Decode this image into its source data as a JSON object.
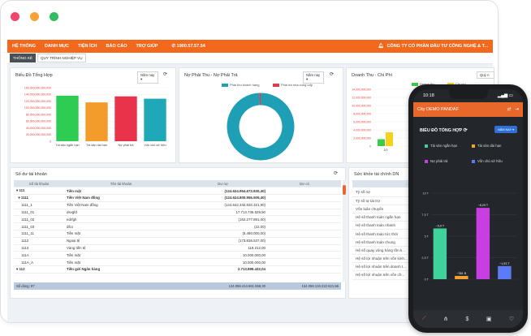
{
  "menu": {
    "items": [
      "HỆ THỐNG",
      "DANH MỤC",
      "TIỆN ÍCH",
      "BÁO CÁO",
      "TRỢ GIÚP"
    ],
    "phone": "1900.57.57.54",
    "company": "CÔNG TY CỔ PHẦN ĐẦU TƯ CÔNG NGHỆ & T..."
  },
  "tabs": [
    "THỐNG KÊ",
    "QUY TRÌNH NGHIỆP VỤ"
  ],
  "overview": {
    "title": "Biểu Đồ Tổng Hợp",
    "period": "Năm nay",
    "y_ticks": [
      "160,000,000,000,000",
      "140,000,000,000,000",
      "120,000,000,000,000",
      "100,000,000,000,000",
      "80,000,000,000,000",
      "60,000,000,000,000",
      "40,000,000,000,000",
      "20,000,000,000,000",
      "0"
    ]
  },
  "receivable": {
    "title": "Nợ Phải Thu - Nợ Phải Trả",
    "period": "Năm nay",
    "legend": [
      {
        "name": "Phải thu khách hàng",
        "color": "#1f9fb5"
      },
      {
        "name": "Phải trả nhà cung cấp",
        "color": "#e53945"
      }
    ]
  },
  "income": {
    "title": "Doanh Thu - Chi Phí",
    "period": "Quý n",
    "legend": [
      {
        "name": "Doanh thu",
        "color": "#3ec94a"
      },
      {
        "name": "Chi phí",
        "color": "#f6d21a"
      }
    ],
    "y_ticks": [
      "14,000,000,000",
      "12,000,000,000",
      "10,000,000,000",
      "8,000,000,000",
      "6,000,000,000",
      "4,000,000,000",
      "2,000,000,000",
      "0"
    ],
    "x_label": "1/0"
  },
  "balance": {
    "title": "Số dư tài khoản",
    "headers": [
      "Số tài khoản",
      "Tên tài khoản",
      "Dư nợ",
      "Dư có"
    ],
    "rows": [
      {
        "acct": "111",
        "name": "Tiền mặt",
        "debit": "(124.624.954.673.830,40)",
        "credit": "",
        "level": 0
      },
      {
        "acct": "1111",
        "name": "Tiền Việt Nam đồng",
        "debit": "(124.624.800.955.505,40)",
        "credit": "",
        "level": 1
      },
      {
        "acct": "1111_1",
        "name": "Tiền Việt Nam đồng",
        "debit": "(124.642.342.833.321,90)",
        "credit": "",
        "level": 2
      },
      {
        "acct": "1111_01",
        "name": "dsvgfd",
        "debit": "17.713.735.529,50",
        "credit": "",
        "level": 2
      },
      {
        "acct": "1111_02",
        "name": "edrfgh",
        "debit": "(162.277.891,00)",
        "credit": "",
        "level": 2
      },
      {
        "acct": "1111_03",
        "name": "dfcx",
        "debit": "(22,00)",
        "credit": "",
        "level": 2
      },
      {
        "acct": "1111_11",
        "name": "Tiền mặt",
        "debit": "(5.480.000,00)",
        "credit": "",
        "level": 2
      },
      {
        "acct": "1112",
        "name": "Ngoại tệ",
        "debit": "(173.836.537,00)",
        "credit": "",
        "level": 2
      },
      {
        "acct": "1113",
        "name": "Vàng tiền tệ",
        "debit": "118.212,00",
        "credit": "",
        "level": 2
      },
      {
        "acct": "111A",
        "name": "Tiền mặt",
        "debit": "10.000.000,00",
        "credit": "",
        "level": 2
      },
      {
        "acct": "111A_A",
        "name": "Tiền mặt",
        "debit": "10.000.000,00",
        "credit": "",
        "level": 2
      },
      {
        "acct": "112",
        "name": "Tiền gửi Ngân hàng",
        "debit": "2.713.899.432,04",
        "credit": "",
        "level": 0
      }
    ],
    "footer": {
      "label": "Số dòng: 97",
      "debit": "134.058.414.861.558,30",
      "credit": "134.058.134.222.821,56"
    }
  },
  "health": {
    "title": "Sức khỏe tài chính DN",
    "header": "Chỉ số",
    "items": [
      "Tỷ số nợ",
      "Tỷ số tự tài trợ",
      "Vốn luân chuyển",
      "Hệ số thanh toán ngắn hạn",
      "Hệ số thanh toán nhanh",
      "Hệ số thanh toán tức thời",
      "Hệ số thanh toán chung",
      "Hệ số quay vòng hàng tồn k...",
      "Hệ số lợi nhuận trên vốn kinh...",
      "Hệ số lợi nhuận trên doanh t...",
      "Hệ số lợi nhuận trên vốn ch..."
    ]
  },
  "mobile": {
    "time": "10:18",
    "org": "City DEMO PANDAF",
    "title": "BIỂU ĐỒ TỔNG HỢP",
    "period": "NĂM NAY",
    "legend": [
      {
        "name": "Tài sản ngắn hạn",
        "color": "#3fd39b"
      },
      {
        "name": "Tài sản dài hạn",
        "color": "#f6a032"
      },
      {
        "name": "Nợ phải trả",
        "color": "#c93ee0"
      },
      {
        "name": "Vốn chủ sở hữu",
        "color": "#5b7cf4"
      }
    ],
    "y_ticks": [
      "10 T",
      "7,5 T",
      "5 T",
      "2,5 T",
      "0 T"
    ],
    "bar_labels": [
      "~5,9 T",
      "~381 B",
      "~8,29 T",
      "~1,53 T"
    ],
    "nav_icons": [
      "chart-icon",
      "org-icon",
      "dollar-icon",
      "report-icon",
      "heart-icon"
    ]
  },
  "colors": {
    "orange": "#f2691d",
    "green_bar": "#2ecc52",
    "orange_bar": "#f39c2c",
    "red_bar": "#e8334a",
    "teal_bar": "#1fa8b8"
  },
  "chart_data": [
    {
      "type": "bar",
      "title": "Biểu Đồ Tổng Hợp",
      "categories": [
        "Tài sản ngắn hạn",
        "Tài sản dài hạn",
        "Nợ phải trả",
        "Vốn chủ sở hữu"
      ],
      "values": [
        136000000000000,
        116000000000000,
        134000000000000,
        127000000000000
      ],
      "ylim": [
        0,
        160000000000000
      ]
    },
    {
      "type": "pie",
      "title": "Nợ Phải Thu - Nợ Phải Trả",
      "categories": [
        "Phải thu khách hàng",
        "Phải trả nhà cung cấp"
      ],
      "values": [
        99.3,
        0.7
      ]
    },
    {
      "type": "bar",
      "title": "Doanh Thu - Chi Phí",
      "categories": [
        "1/0"
      ],
      "series": [
        {
          "name": "Doanh thu",
          "values": [
            1700000000
          ]
        },
        {
          "name": "Chi phí",
          "values": [
            3400000000
          ]
        }
      ],
      "ylim": [
        0,
        14000000000
      ]
    },
    {
      "type": "bar",
      "title": "BIỂU ĐỒ TỔNG HỢP",
      "categories": [
        "Tài sản ngắn hạn",
        "Tài sản dài hạn",
        "Nợ phải trả",
        "Vốn chủ sở hữu"
      ],
      "values": [
        5.9,
        0.381,
        8.29,
        1.53
      ],
      "ylim": [
        0,
        10
      ]
    }
  ]
}
